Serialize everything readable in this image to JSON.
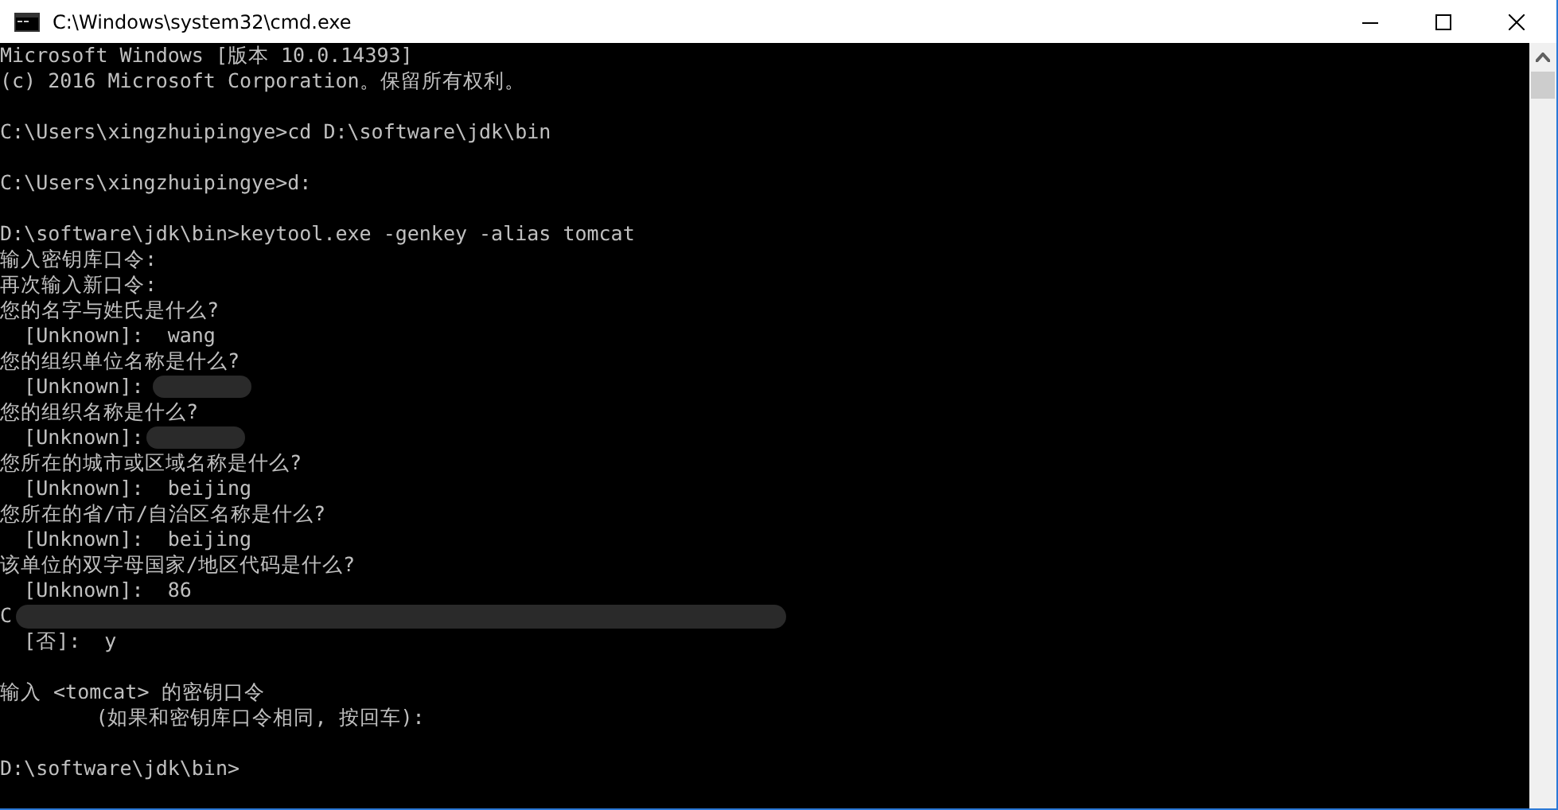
{
  "window": {
    "title": "C:\\Windows\\system32\\cmd.exe"
  },
  "console": {
    "lines": [
      {
        "kind": "text",
        "text": "Microsoft Windows [版本 10.0.14393]"
      },
      {
        "kind": "text",
        "text": "(c) 2016 Microsoft Corporation。保留所有权利。"
      },
      {
        "kind": "blank"
      },
      {
        "kind": "text",
        "text": "C:\\Users\\xingzhuipingye>cd D:\\software\\jdk\\bin"
      },
      {
        "kind": "blank"
      },
      {
        "kind": "text",
        "text": "C:\\Users\\xingzhuipingye>d:"
      },
      {
        "kind": "blank"
      },
      {
        "kind": "text",
        "text": "D:\\software\\jdk\\bin>keytool.exe -genkey -alias tomcat"
      },
      {
        "kind": "text",
        "text": "输入密钥库口令:"
      },
      {
        "kind": "text",
        "text": "再次输入新口令:"
      },
      {
        "kind": "text",
        "text": "您的名字与姓氏是什么?"
      },
      {
        "kind": "text",
        "text": "  [Unknown]:  wang"
      },
      {
        "kind": "text",
        "text": "您的组织单位名称是什么?"
      },
      {
        "kind": "redacted",
        "text": "  [Unknown]:"
      },
      {
        "kind": "text",
        "text": "您的组织名称是什么?"
      },
      {
        "kind": "redacted",
        "text": "  [Unknown]:"
      },
      {
        "kind": "text",
        "text": "您所在的城市或区域名称是什么?"
      },
      {
        "kind": "text",
        "text": "  [Unknown]:  beijing"
      },
      {
        "kind": "text",
        "text": "您所在的省/市/自治区名称是什么?"
      },
      {
        "kind": "text",
        "text": "  [Unknown]:  beijing"
      },
      {
        "kind": "text",
        "text": "该单位的双字母国家/地区代码是什么?"
      },
      {
        "kind": "text",
        "text": "  [Unknown]:  86"
      },
      {
        "kind": "redacted",
        "text": "C"
      },
      {
        "kind": "text",
        "text": "  [否]:  y"
      },
      {
        "kind": "blank"
      },
      {
        "kind": "text",
        "text": "输入 <tomcat> 的密钥口令"
      },
      {
        "kind": "text",
        "text": "        (如果和密钥库口令相同, 按回车):"
      },
      {
        "kind": "blank"
      },
      {
        "kind": "text",
        "text": "D:\\software\\jdk\\bin>"
      }
    ]
  }
}
